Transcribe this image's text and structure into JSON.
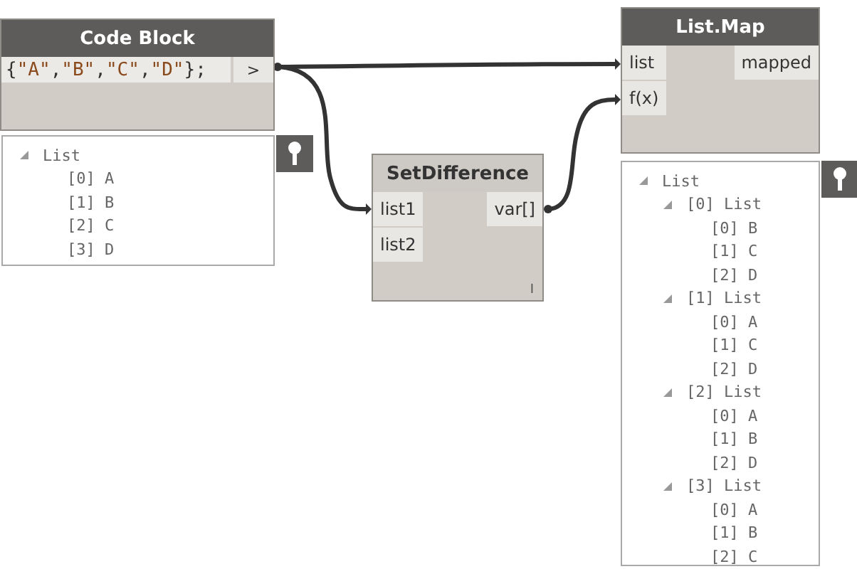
{
  "nodes": [
    {
      "kind": "code",
      "title": "Code Block",
      "color": "#5e5c5a",
      "code": "{\"A\",\"B\",\"C\",\"D\"};",
      "outputs": [
        ">"
      ],
      "preview": {
        "label": "List",
        "expanded": true,
        "children": [
          {
            "label": "[0] A"
          },
          {
            "label": "[1] B"
          },
          {
            "label": "[2] C"
          },
          {
            "label": "[3] D"
          }
        ]
      }
    },
    {
      "kind": "function",
      "title": "SetDifference",
      "color": "#cdc9c4",
      "inputs": [
        "list1",
        "list2"
      ],
      "outputs": [
        "var[]"
      ],
      "lacing": "I"
    },
    {
      "kind": "function",
      "title": "List.Map",
      "color": "#5e5c5a",
      "inputs": [
        "list",
        "f(x)"
      ],
      "outputs": [
        "mapped"
      ],
      "preview": {
        "label": "List",
        "expanded": true,
        "children": [
          {
            "label": "[0] List",
            "expanded": true,
            "children": [
              {
                "label": "[0] B"
              },
              {
                "label": "[1] C"
              },
              {
                "label": "[2] D"
              }
            ]
          },
          {
            "label": "[1] List",
            "expanded": true,
            "children": [
              {
                "label": "[0] A"
              },
              {
                "label": "[1] C"
              },
              {
                "label": "[2] D"
              }
            ]
          },
          {
            "label": "[2] List",
            "expanded": true,
            "children": [
              {
                "label": "[0] A"
              },
              {
                "label": "[1] B"
              },
              {
                "label": "[2] D"
              }
            ]
          },
          {
            "label": "[3] List",
            "expanded": true,
            "children": [
              {
                "label": "[0] A"
              },
              {
                "label": "[1] B"
              },
              {
                "label": "[2] C"
              }
            ]
          }
        ]
      }
    }
  ]
}
